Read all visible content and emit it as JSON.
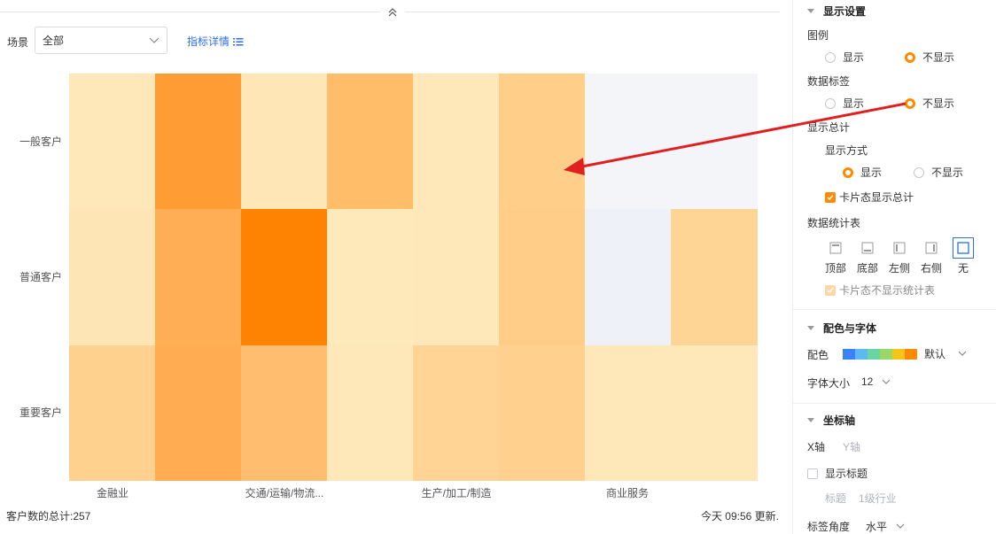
{
  "toolbar": {
    "scene_label": "场景",
    "scene_value": "全部",
    "detail_link": "指标详情"
  },
  "heatmap": {
    "rows": [
      "一般客户",
      "普通客户",
      "重要客户"
    ],
    "x_labels": [
      "金融业",
      "交通/运输/物流...",
      "生产/加工/制造",
      "商业服务"
    ],
    "colors": [
      [
        "#fee7b8",
        "#ff9c33",
        "#fee6b6",
        "#ffbc69",
        "#fee8b9",
        "#ffcf8a",
        "#f4f5f9",
        "#f4f5f9"
      ],
      [
        "#fee5b5",
        "#ffae55",
        "#ff8302",
        "#fee9ba",
        "#fee8b9",
        "#ffcd88",
        "#eef1f8",
        "#ffd596"
      ],
      [
        "#ffd18f",
        "#ffac52",
        "#ffbe6f",
        "#fee7b8",
        "#ffd494",
        "#ffd08e",
        "#fee8b9",
        "#fee8b9"
      ]
    ]
  },
  "footer": {
    "total": "客户数的总计:257",
    "updated": "今天 09:56 更新."
  },
  "panel": {
    "display_settings": {
      "title": "显示设置",
      "legend_label": "图例",
      "legend_show": "显示",
      "legend_hide": "不显示",
      "data_label_label": "数据标签",
      "data_label_show": "显示",
      "data_label_hide": "不显示",
      "total_label": "显示总计",
      "mode_label": "显示方式",
      "mode_show": "显示",
      "mode_hide": "不显示",
      "card_total": "卡片态显示总计",
      "stats_table_label": "数据统计表",
      "positions": [
        "顶部",
        "底部",
        "左侧",
        "右侧",
        "无"
      ],
      "card_no_stats": "卡片态不显示统计表"
    },
    "color_font": {
      "title": "配色与字体",
      "color_label": "配色",
      "color_value": "默认",
      "palette": [
        "#3b82f6",
        "#60b8f0",
        "#6dd3a4",
        "#9bd86a",
        "#f5c518",
        "#ff8a00"
      ],
      "font_size_label": "字体大小",
      "font_size_value": "12"
    },
    "axis": {
      "title": "坐标轴",
      "tab_x": "X轴",
      "tab_y": "Y轴",
      "show_title": "显示标题",
      "title_label": "标题",
      "title_value": "1级行业",
      "angle_label": "标签角度",
      "angle_value": "水平"
    }
  }
}
